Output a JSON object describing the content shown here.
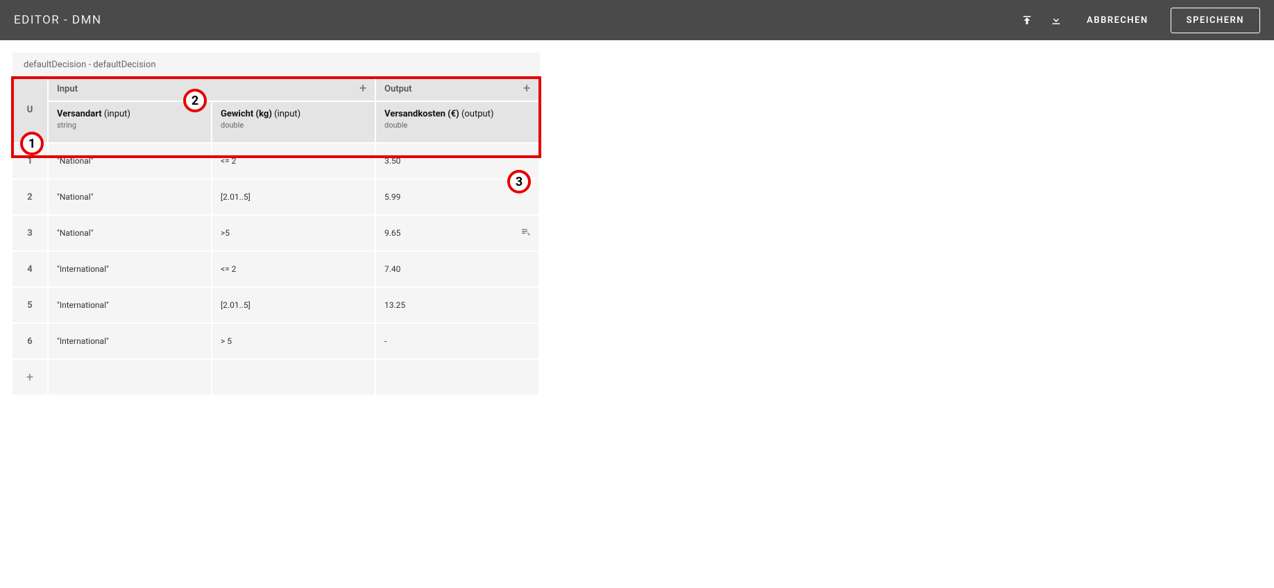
{
  "topbar": {
    "title": "EDITOR - DMN",
    "cancel": "ABBRECHEN",
    "save": "SPEICHERN"
  },
  "decision": {
    "breadcrumb": "defaultDecision - defaultDecision",
    "hitPolicy": "U",
    "inputLabel": "Input",
    "outputLabel": "Output",
    "columns": [
      {
        "name": "Versandart",
        "direction": "(input)",
        "dtype": "string"
      },
      {
        "name": "Gewicht (kg)",
        "direction": "(input)",
        "dtype": "double"
      },
      {
        "name": "Versandkosten (€)",
        "direction": "(output)",
        "dtype": "double"
      }
    ],
    "rows": [
      {
        "num": "1",
        "c0": "\"National\"",
        "c1": "<= 2",
        "c2": "3.50"
      },
      {
        "num": "2",
        "c0": "\"National\"",
        "c1": "[2.01..5]",
        "c2": "5.99"
      },
      {
        "num": "3",
        "c0": "\"National\"",
        "c1": ">5",
        "c2": "9.65"
      },
      {
        "num": "4",
        "c0": "\"International\"",
        "c1": "<= 2",
        "c2": "7.40"
      },
      {
        "num": "5",
        "c0": "\"International\"",
        "c1": "[2.01..5]",
        "c2": "13.25"
      },
      {
        "num": "6",
        "c0": "\"International\"",
        "c1": "> 5",
        "c2": "-"
      }
    ]
  },
  "annotations": {
    "n1": "1",
    "n2": "2",
    "n3": "3"
  }
}
